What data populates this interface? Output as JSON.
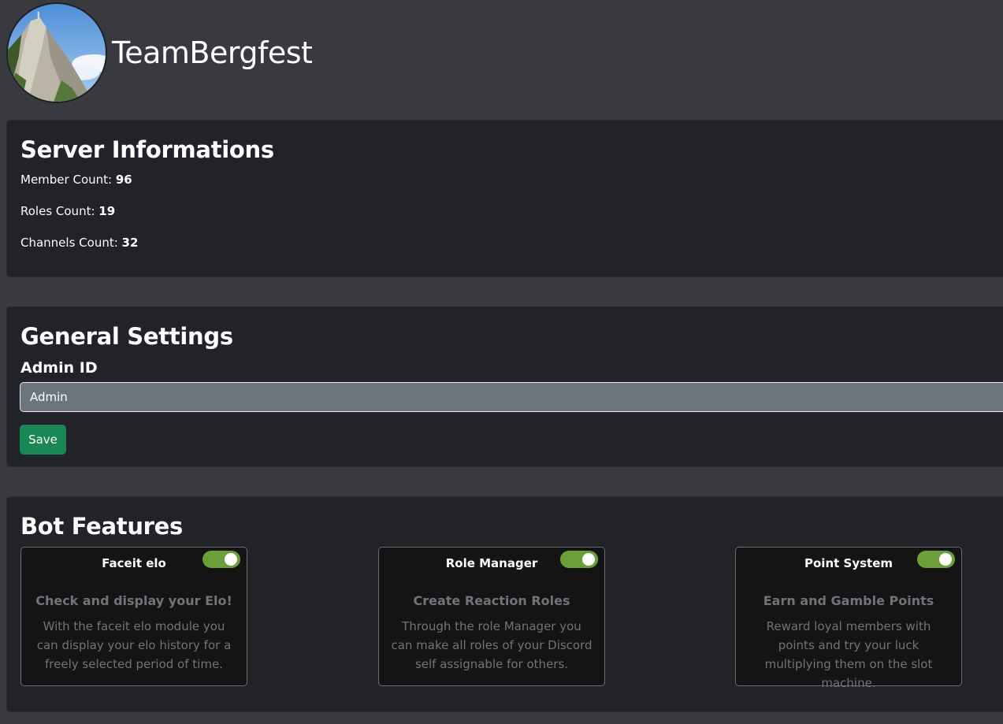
{
  "server": {
    "name": "TeamBergfest",
    "avatar_icon": "mountain-avatar"
  },
  "info": {
    "title": "Server Informations",
    "member_label": "Member Count: ",
    "member_value": "96",
    "roles_label": "Roles Count: ",
    "roles_value": "19",
    "channels_label": "Channels Count: ",
    "channels_value": "32"
  },
  "settings": {
    "title": "General Settings",
    "admin_label": "Admin ID",
    "admin_value": "Admin",
    "save_label": "Save"
  },
  "features": {
    "title": "Bot Features",
    "items": [
      {
        "name": "Faceit elo",
        "enabled": true,
        "title": "Check and display your Elo!",
        "description": "With the faceit elo module you can display your elo history for a freely selected period of time."
      },
      {
        "name": "Role Manager",
        "enabled": true,
        "title": "Create Reaction Roles",
        "description": "Through the role Manager you can make all roles of your Discord self assignable for others."
      },
      {
        "name": "Point System",
        "enabled": true,
        "title": "Earn and Gamble Points",
        "description": "Reward loyal members with points and try your luck multiplying them on the slot machine."
      }
    ]
  },
  "colors": {
    "background": "#393a3f",
    "card": "#212328",
    "save_button": "#198754",
    "toggle_on": "#6a9f3a",
    "input_bg": "#6c757d"
  }
}
